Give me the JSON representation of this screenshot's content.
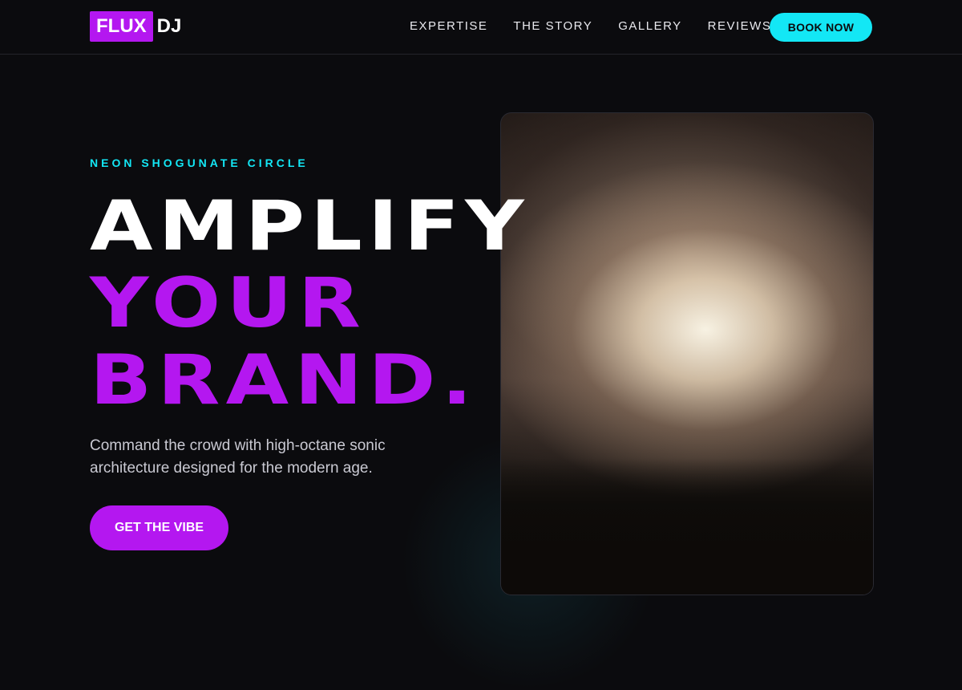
{
  "logo": {
    "box_text": "FLUX",
    "text": "DJ"
  },
  "nav": {
    "links": [
      {
        "label": "EXPERTISE"
      },
      {
        "label": "THE STORY"
      },
      {
        "label": "GALLERY"
      },
      {
        "label": "REVIEWS"
      }
    ],
    "cta_label": "BOOK NOW"
  },
  "hero": {
    "eyebrow": "NEON SHOGUNATE CIRCLE",
    "headline": [
      "AMPLIFY",
      "YOUR",
      "BRAND."
    ],
    "subtitle": "Command the crowd with high-octane sonic architecture designed for the modern age.",
    "cta_label": "GET THE VIBE"
  },
  "colors": {
    "background": "#0b0b0e",
    "accent_purple": "#b417f0",
    "accent_cyan": "#13e7f5",
    "text": "#ffffff"
  }
}
